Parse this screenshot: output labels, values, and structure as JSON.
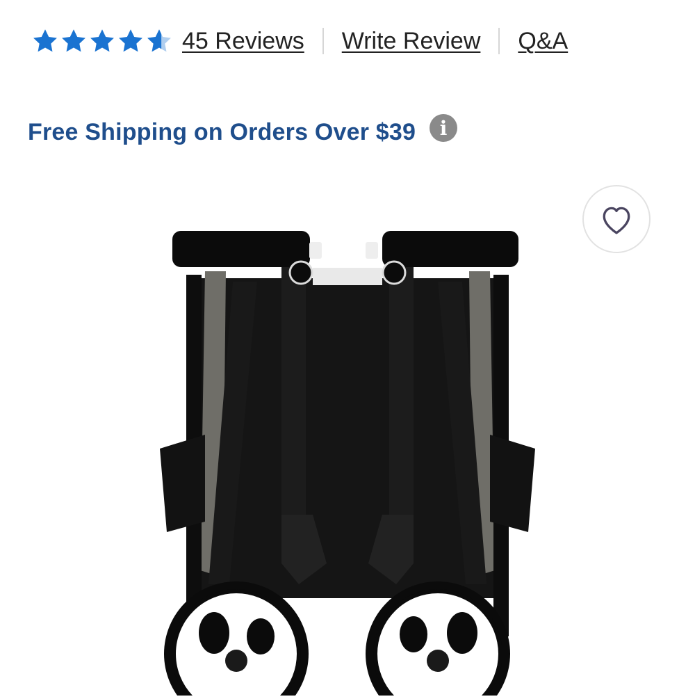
{
  "rating": {
    "stars": 4.5,
    "reviews_label": "45 Reviews",
    "write_review_label": "Write Review",
    "qa_label": "Q&A",
    "star_color": "#1a73d1"
  },
  "shipping": {
    "text": "Free Shipping on Orders Over $39",
    "info_icon_glyph": "i",
    "text_color": "#1f4e8c"
  },
  "favorite": {
    "icon": "heart-outline-icon"
  },
  "product_image": {
    "subject": "folded stroller"
  }
}
